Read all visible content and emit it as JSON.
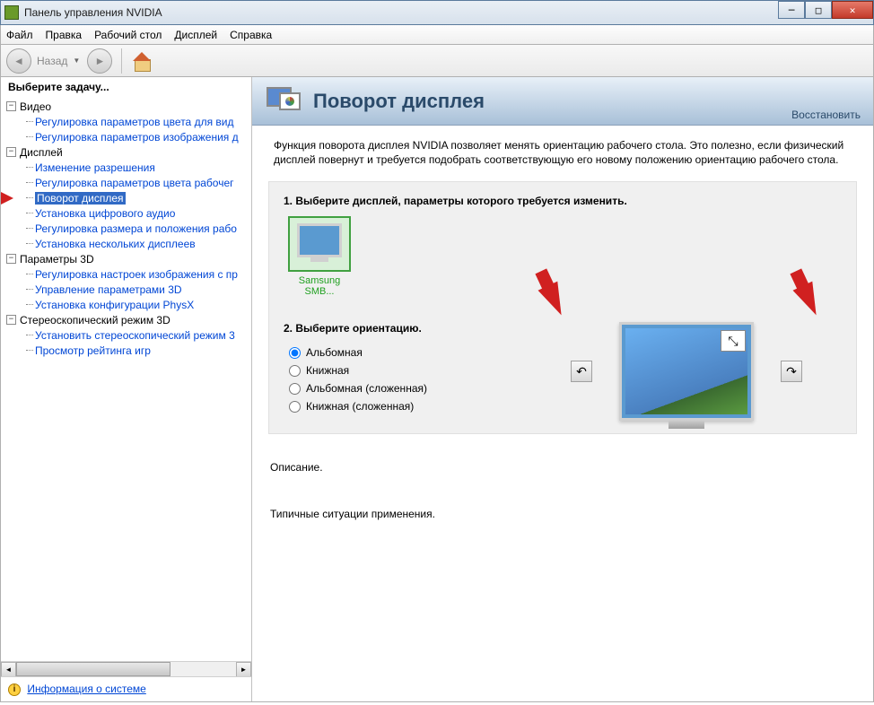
{
  "window": {
    "title": "Панель управления NVIDIA"
  },
  "menu": {
    "file": "Файл",
    "edit": "Правка",
    "desktop": "Рабочий стол",
    "display": "Дисплей",
    "help": "Справка"
  },
  "toolbar": {
    "back": "Назад"
  },
  "sidebar": {
    "title": "Выберите задачу...",
    "groups": [
      {
        "label": "Видео",
        "items": [
          "Регулировка параметров цвета для вид",
          "Регулировка параметров изображения д"
        ]
      },
      {
        "label": "Дисплей",
        "items": [
          "Изменение разрешения",
          "Регулировка параметров цвета рабочег",
          "Поворот дисплея",
          "Установка цифрового аудио",
          "Регулировка размера и положения рабо",
          "Установка нескольких дисплеев"
        ]
      },
      {
        "label": "Параметры 3D",
        "items": [
          "Регулировка настроек изображения с пр",
          "Управление параметрами 3D",
          "Установка конфигурации PhysX"
        ]
      },
      {
        "label": "Стереоскопический режим 3D",
        "items": [
          "Установить стереоскопический режим 3",
          "Просмотр рейтинга игр"
        ]
      }
    ],
    "selected": "Поворот дисплея",
    "sysinfo": "Информация о системе"
  },
  "content": {
    "title": "Поворот дисплея",
    "restore": "Восстановить",
    "description": "Функция поворота дисплея NVIDIA позволяет менять ориентацию рабочего стола. Это полезно, если физический дисплей повернут и требуется подобрать соответствующую его новому положению ориентацию рабочего стола.",
    "step1_title": "1. Выберите дисплей, параметры которого требуется изменить.",
    "display_name": "Samsung SMB...",
    "step2_title": "2. Выберите ориентацию.",
    "orientations": [
      "Альбомная",
      "Книжная",
      "Альбомная (сложенная)",
      "Книжная (сложенная)"
    ],
    "selected_orientation": "Альбомная",
    "desc_label": "Описание.",
    "usage_label": "Типичные ситуации применения."
  }
}
